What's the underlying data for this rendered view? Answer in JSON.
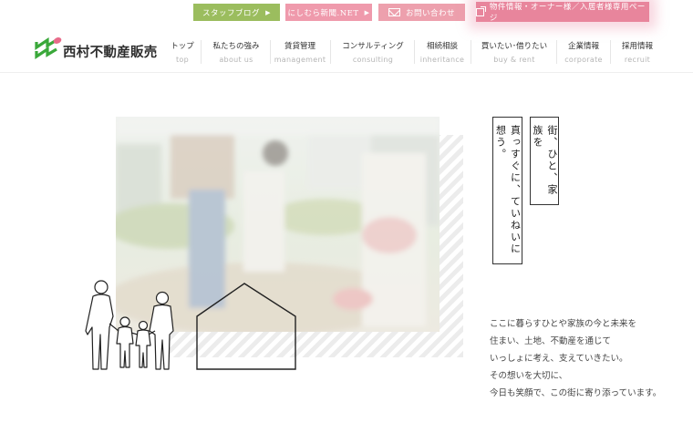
{
  "utility": {
    "staff_blog": "スタッフブログ",
    "news": "にしむら新聞.NET",
    "contact": "お問い合わせ",
    "owner_page": "物件情報・オーナー様／入居者様専用ページ",
    "arrow": "▶"
  },
  "logo": {
    "text": "西村不動産販売"
  },
  "nav": [
    {
      "ja": "トップ",
      "en": "top"
    },
    {
      "ja": "私たちの強み",
      "en": "about us"
    },
    {
      "ja": "賃貸管理",
      "en": "management"
    },
    {
      "ja": "コンサルティング",
      "en": "consulting"
    },
    {
      "ja": "相続相談",
      "en": "inheritance"
    },
    {
      "ja": "買いたい･借りたい",
      "en": "buy & rent"
    },
    {
      "ja": "企業情報",
      "en": "corporate"
    },
    {
      "ja": "採用情報",
      "en": "recruit"
    }
  ],
  "hero": {
    "tagline_1": "街、ひと、家族を",
    "tagline_2": "真っすぐに、ていねいに想う。",
    "paragraph": [
      "ここに暮らすひとや家族の今と未来を",
      "住まい、土地、不動産を通じて",
      "いっしょに考え、支えていきたい。",
      "その想いを大切に、",
      "今日も笑顔で、この街に寄り添っています。"
    ]
  },
  "colors": {
    "staff_green": "#9bbd5e",
    "news_pink": "#ef9aac",
    "owner_pink": "#e8859c",
    "logo_green": "#3aa83a",
    "logo_pink": "#e86b8a"
  }
}
